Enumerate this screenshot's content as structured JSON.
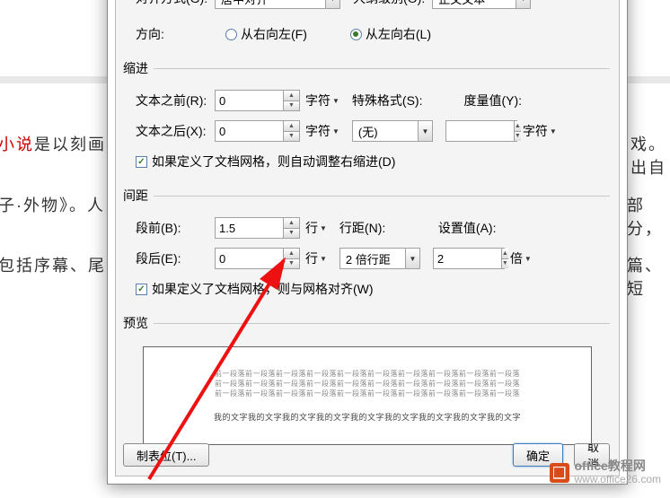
{
  "bg": {
    "line1a": "小说",
    "line1b": "是以刻画",
    "line1c": "戏。出自",
    "line2a": "子·外物》。人",
    "line2b": "部分，",
    "line3a": "包括序幕、尾",
    "line3b": "篇、短"
  },
  "topRow": {
    "alignLabel": "对齐方式(G):",
    "alignValue": "居中对齐",
    "outlineLabel": "大纲级别(O):",
    "outlineValue": "正文文本"
  },
  "direction": {
    "label": "方向:",
    "rtl": "从右向左(F)",
    "ltr": "从左向右(L)"
  },
  "indent": {
    "section": "缩进",
    "beforeLabel": "文本之前(R):",
    "beforeValue": "0",
    "afterLabel": "文本之后(X):",
    "afterValue": "0",
    "unit": "字符",
    "specialLabel": "特殊格式(S):",
    "specialValue": "(无)",
    "measureLabel": "度量值(Y):",
    "checkbox": "如果定义了文档网格，则自动调整右缩进(D)"
  },
  "spacing": {
    "section": "间距",
    "beforeLabel": "段前(B):",
    "beforeValue": "1.5",
    "afterLabel": "段后(E):",
    "afterValue": "0",
    "unit": "行",
    "lineSpacingLabel": "行距(N):",
    "lineSpacingValue": "2 倍行距",
    "setValueLabel": "设置值(A):",
    "setValue": "2",
    "setUnit": "倍",
    "checkbox": "如果定义了文档网格，则与网格对齐(W)"
  },
  "preview": {
    "section": "预览",
    "ghost": "前一段落前一段落前一段落前一段落前一段落前一段落前一段落前一段落前一段落前一段落",
    "sample": "我的文字我的文字我的文字我的文字我的文字我的文字我的文字我的文字我的文字"
  },
  "buttons": {
    "tabs": "制表位(T)...",
    "ok": "确定",
    "cancel": "取消"
  },
  "watermark": {
    "text1": "office教程网",
    "text2": "www.office26.com"
  }
}
